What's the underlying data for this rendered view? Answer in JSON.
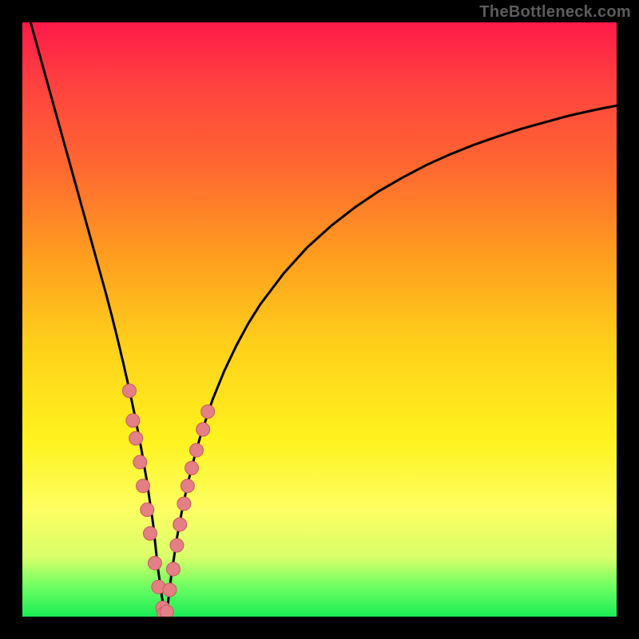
{
  "watermark": "TheBottleneck.com",
  "colors": {
    "frame": "#000000",
    "curve": "#000000",
    "marker_fill": "#e37f85",
    "marker_stroke": "#c75b60"
  },
  "chart_data": {
    "type": "line",
    "title": "",
    "xlabel": "",
    "ylabel": "",
    "xlim": [
      0,
      100
    ],
    "ylim": [
      0,
      100
    ],
    "grid": false,
    "legend": false,
    "x": [
      0,
      2,
      4,
      6,
      8,
      10,
      12,
      14,
      15,
      16,
      17,
      18,
      19,
      20,
      21,
      22,
      22.8,
      23.5,
      24,
      24.5,
      25,
      26,
      27,
      28,
      29,
      30,
      32,
      34,
      36,
      38,
      40,
      44,
      48,
      52,
      56,
      60,
      64,
      68,
      72,
      76,
      80,
      84,
      88,
      92,
      96,
      100
    ],
    "values": [
      105,
      97.8,
      90.6,
      83.4,
      76.2,
      69,
      61.8,
      54.6,
      50.8,
      46.8,
      42.6,
      38.2,
      33.5,
      28.3,
      22.5,
      15.6,
      8.2,
      3.2,
      0.6,
      2.2,
      6.5,
      13.2,
      18.6,
      23.1,
      27,
      30.5,
      36.5,
      41.4,
      45.6,
      49.3,
      52.5,
      57.8,
      62.2,
      65.8,
      68.9,
      71.6,
      73.9,
      76,
      77.8,
      79.4,
      80.8,
      82.1,
      83.2,
      84.3,
      85.2,
      86
    ],
    "series": [
      {
        "name": "bottleneck-curve",
        "role": "primary-curve"
      },
      {
        "name": "left-cluster-markers",
        "role": "scatter-overlay",
        "points_x": [
          18.0,
          18.6,
          19.1,
          19.8,
          20.3,
          21.0,
          21.5,
          22.3,
          22.9,
          23.6
        ],
        "points_y": [
          38.0,
          33.0,
          30.0,
          26.0,
          22.0,
          18.0,
          14.0,
          9.0,
          5.0,
          1.5
        ]
      },
      {
        "name": "right-cluster-markers",
        "role": "scatter-overlay",
        "points_x": [
          24.8,
          25.4,
          26.0,
          26.5,
          27.2,
          27.8,
          28.5,
          29.3,
          30.4,
          31.2
        ],
        "points_y": [
          4.5,
          8.0,
          12.0,
          15.5,
          19.0,
          22.0,
          25.0,
          28.0,
          31.5,
          34.5
        ]
      },
      {
        "name": "bottom-cluster-markers",
        "role": "scatter-overlay",
        "points_x": [
          23.8,
          24.3
        ],
        "points_y": [
          0.5,
          0.8
        ]
      }
    ]
  }
}
